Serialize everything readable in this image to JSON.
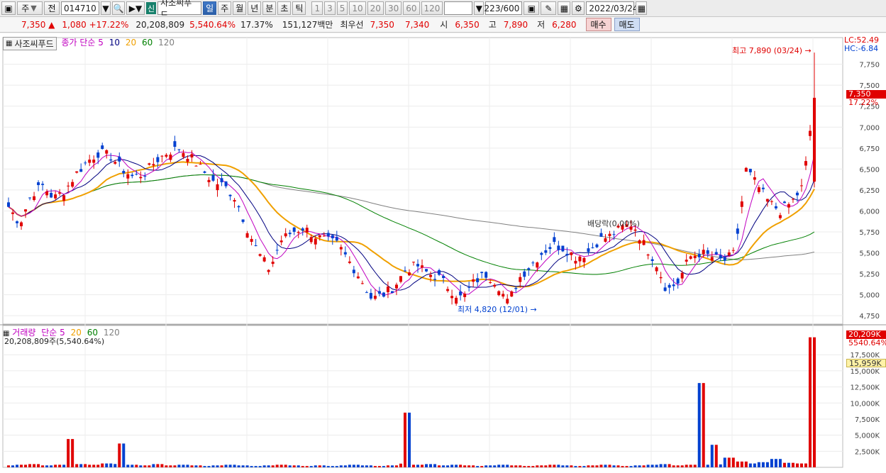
{
  "toolbar": {
    "market": "주",
    "prev_label": "전",
    "code": "014710",
    "new_badge": "신",
    "stock_name": "사조씨푸드",
    "periods": [
      "일",
      "주",
      "월",
      "년",
      "분",
      "초",
      "틱"
    ],
    "active_period": "일",
    "nums": [
      "1",
      "3",
      "5",
      "10",
      "20",
      "30",
      "60",
      "120"
    ],
    "count": "223/600",
    "date": "2022/03/24"
  },
  "quote": {
    "price": "7,350",
    "change": "1,080",
    "rate": "+17.22%",
    "volume": "20,208,809",
    "vol_rate": "5,540.64%",
    "turnover": "17.37%",
    "amount": "151,127백만",
    "pref_label": "최우선",
    "ask": "7,350",
    "bid": "7,340",
    "open_label": "시",
    "open": "6,350",
    "high_label": "고",
    "high": "7,890",
    "low_label": "저",
    "low": "6,280",
    "buy_label": "매수",
    "sell_label": "매도"
  },
  "price_panel": {
    "title": "사조씨푸드",
    "legend_prefix": "종가 단순",
    "ma": [
      "5",
      "10",
      "20",
      "60",
      "120"
    ],
    "lc": "LC:52.49",
    "hc": "HC:-6.84",
    "high_note": "최고 7,890 (03/24)",
    "low_note": "최저 4,820 (12/01)",
    "dividend_note": "배당락(0.00%)",
    "price_tag": "7,350",
    "rate_tag": "17.22%",
    "y_ticks": [
      "7,750",
      "7,500",
      "7,250",
      "7,000",
      "6,750",
      "6,500",
      "6,250",
      "6,000",
      "5,750",
      "5,500",
      "5,250",
      "5,000",
      "4,750"
    ]
  },
  "volume_panel": {
    "label": "거래량",
    "legend_prefix": "단순",
    "ma": [
      "5",
      "20",
      "60",
      "120"
    ],
    "value_text": "20,208,809주(5,540.64%)",
    "vol_tag": "20,209K",
    "pct_tag": "5540.64%",
    "ma_tag": "15,959K",
    "y_ticks": [
      "17,500K",
      "15,000K",
      "12,500K",
      "10,000K",
      "7,500K",
      "5,000K",
      "2,500K"
    ]
  },
  "colors": {
    "up": "#e00000",
    "down": "#0040d0",
    "ma5": "#c000c0",
    "ma10": "#000080",
    "ma20": "#f0a000",
    "ma60": "#008000",
    "ma120": "#808080"
  },
  "chart_data": {
    "type": "candlestick",
    "price_range": [
      4650,
      7950
    ],
    "volume_range": [
      0,
      20500
    ],
    "key_points": [
      {
        "label": "high",
        "date": "03/24",
        "value": 7890
      },
      {
        "label": "low",
        "date": "12/01",
        "value": 4820
      },
      {
        "label": "last_close",
        "value": 7350
      }
    ],
    "price_path": [
      6050,
      5850,
      6200,
      6300,
      6150,
      6250,
      6450,
      6600,
      6700,
      6650,
      6500,
      6400,
      6450,
      6600,
      6700,
      6750,
      6650,
      6500,
      6350,
      6300,
      6150,
      5800,
      5500,
      5300,
      5650,
      5750,
      5800,
      5700,
      5650,
      5600,
      5400,
      5200,
      4950,
      5000,
      5100,
      5300,
      5350,
      5250,
      5200,
      5050,
      4950,
      5150,
      5250,
      5150,
      4900,
      5200,
      5350,
      5500,
      5600,
      5550,
      5450,
      5500,
      5650,
      5700,
      5800,
      5850,
      5600,
      5400,
      5050,
      5150,
      5450,
      5500,
      5450,
      5400,
      5500,
      6500,
      6300,
      6100,
      6000,
      6100,
      6300,
      7350
    ],
    "volume_path": [
      300,
      400,
      500,
      300,
      400,
      4400,
      500,
      400,
      600,
      3700,
      400,
      300,
      500,
      300,
      400,
      300,
      200,
      300,
      400,
      300,
      200,
      300,
      400,
      300,
      200,
      300,
      200,
      300,
      400,
      300,
      200,
      300,
      8500,
      400,
      500,
      300,
      400,
      300,
      200,
      300,
      400,
      300,
      200,
      300,
      400,
      300,
      200,
      300,
      400,
      300,
      200,
      300,
      400,
      500,
      300,
      400,
      13100,
      3500,
      1500,
      900,
      600,
      800,
      1300,
      700,
      600,
      20209
    ]
  }
}
